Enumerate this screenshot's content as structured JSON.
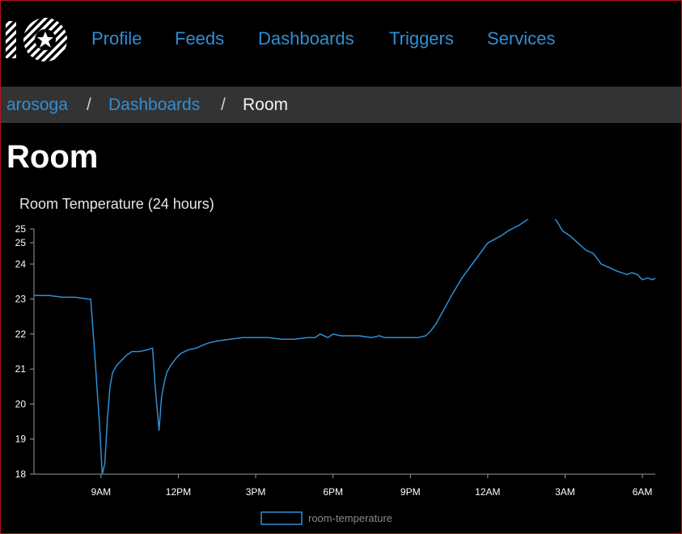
{
  "nav": {
    "items": [
      {
        "label": "Profile"
      },
      {
        "label": "Feeds"
      },
      {
        "label": "Dashboards"
      },
      {
        "label": "Triggers"
      },
      {
        "label": "Services"
      }
    ]
  },
  "breadcrumb": {
    "user": "arosoga",
    "separator": "/",
    "section": "Dashboards",
    "current": "Room"
  },
  "page": {
    "title": "Room"
  },
  "colors": {
    "link": "#2f8fd6",
    "series": "#2f8fd6",
    "breadcrumb_bg": "#333333",
    "background": "#000000"
  },
  "chart_data": {
    "type": "line",
    "title": "Room Temperature (24 hours)",
    "xlabel": "",
    "ylabel": "",
    "ylim": [
      18,
      25
    ],
    "y_ticks": [
      18,
      19,
      20,
      21,
      22,
      23,
      24,
      25,
      25
    ],
    "x_ticks": [
      {
        "label": "9AM",
        "h": 9
      },
      {
        "label": "12PM",
        "h": 12
      },
      {
        "label": "3PM",
        "h": 15
      },
      {
        "label": "6PM",
        "h": 18
      },
      {
        "label": "9PM",
        "h": 21
      },
      {
        "label": "12AM",
        "h": 24
      },
      {
        "label": "3AM",
        "h": 27
      },
      {
        "label": "6AM",
        "h": 30
      }
    ],
    "xlim_hours": [
      6.4,
      30.5
    ],
    "legend_position": "bottom-center",
    "series": [
      {
        "name": "room-temperature",
        "x": [
          6.4,
          6.6,
          7.0,
          7.5,
          8.0,
          8.5,
          8.6,
          8.75,
          8.95,
          9.05,
          9.15,
          9.25,
          9.35,
          9.45,
          9.6,
          9.8,
          10.0,
          10.2,
          10.5,
          10.8,
          11.0,
          11.1,
          11.25,
          11.35,
          11.45,
          11.55,
          11.7,
          11.9,
          12.1,
          12.4,
          12.7,
          13.0,
          13.2,
          13.5,
          14.0,
          14.5,
          15.0,
          15.5,
          16.0,
          16.5,
          17.0,
          17.3,
          17.5,
          17.8,
          18.0,
          18.3,
          18.6,
          19.0,
          19.5,
          19.8,
          20.0,
          20.5,
          21.0,
          21.3,
          21.6,
          21.8,
          22.0,
          22.3,
          22.6,
          23.0,
          23.5,
          24.0,
          24.5,
          24.8,
          25.2,
          25.6,
          26.0,
          26.3,
          26.5,
          26.7,
          26.9,
          27.2,
          27.5,
          27.8,
          28.1,
          28.4,
          28.7,
          29.0,
          29.2,
          29.4,
          29.6,
          29.8,
          30.0,
          30.2,
          30.4,
          30.5
        ],
        "values": [
          23.1,
          23.1,
          23.1,
          23.05,
          23.05,
          23.0,
          23.0,
          21.5,
          19.3,
          18.0,
          18.3,
          19.6,
          20.5,
          20.9,
          21.1,
          21.25,
          21.4,
          21.5,
          21.5,
          21.55,
          21.6,
          20.5,
          19.25,
          20.2,
          20.6,
          20.9,
          21.1,
          21.3,
          21.45,
          21.55,
          21.6,
          21.7,
          21.75,
          21.8,
          21.85,
          21.9,
          21.9,
          21.9,
          21.85,
          21.85,
          21.9,
          21.9,
          22.0,
          21.9,
          22.0,
          21.95,
          21.95,
          21.95,
          21.9,
          21.95,
          21.9,
          21.9,
          21.9,
          21.9,
          21.95,
          22.1,
          22.3,
          22.7,
          23.1,
          23.6,
          24.1,
          24.6,
          24.8,
          24.95,
          25.1,
          25.3,
          25.45,
          25.5,
          25.4,
          25.2,
          24.95,
          24.8,
          24.6,
          24.4,
          24.3,
          24.0,
          23.9,
          23.8,
          23.75,
          23.7,
          23.75,
          23.7,
          23.55,
          23.6,
          23.55,
          23.6
        ]
      }
    ]
  }
}
